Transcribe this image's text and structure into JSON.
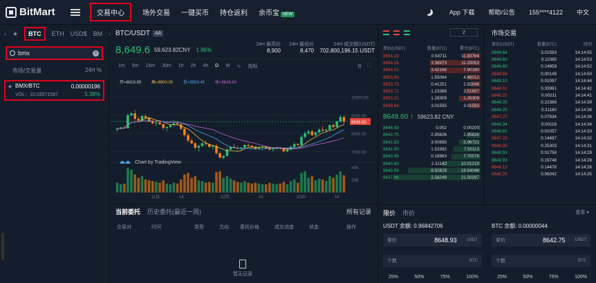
{
  "topbar": {
    "brand": "BitMart",
    "nav": [
      "交易中心",
      "场外交易",
      "一键买币",
      "持仓返利",
      "余币宝"
    ],
    "new_badge": "NEW",
    "app": "App 下载",
    "help": "帮助/公告",
    "user": "155****4122",
    "lang": "中文"
  },
  "left": {
    "tabs": [
      "BTC",
      "ETH",
      "USD$",
      "BM"
    ],
    "search_value": "bmx",
    "col_market": "市场/交易量",
    "col_change": "24H %",
    "pair": {
      "name": "BMX/BTC",
      "vol": "VOL：10.02071597",
      "price": "0.00000196",
      "change": "5.38%"
    }
  },
  "header": {
    "pair": "BTC/USDT",
    "badge": "AA",
    "price": "8,649.6",
    "cny": "59,623.82CNY",
    "change": "1.86%",
    "stats": [
      {
        "label": "24H 最高价",
        "value": "8,900"
      },
      {
        "label": "24H 最低价",
        "value": "8,470"
      },
      {
        "label": "24H 成交额(USDT)",
        "value": "702,800,196.15 USDT"
      }
    ]
  },
  "toolbar": {
    "intervals": [
      "1m",
      "5m",
      "15m",
      "30m",
      "1h",
      "2h",
      "4h",
      "D",
      "W"
    ],
    "active": "D",
    "indicator": "指标"
  },
  "chart_data": {
    "type": "candlestick",
    "ma_labels": [
      "开=8818.89",
      "高=8900.00",
      "低=8569.45",
      "收=8649.60"
    ],
    "y_ticks": [
      "10000.00",
      "9000.00",
      "8000.00",
      "7000.00"
    ],
    "vol_ticks": [
      "40K",
      "20K"
    ],
    "x_ticks": [
      "11月",
      "14",
      "12月",
      "14",
      "2020",
      "14"
    ],
    "current_price": "8649.60",
    "watermark": "Chart by TradingView",
    "candles": [
      [
        8200,
        8300,
        8100,
        8250
      ],
      [
        8250,
        8350,
        8200,
        8320
      ],
      [
        8320,
        8400,
        8250,
        8280
      ],
      [
        8280,
        9100,
        8250,
        9000
      ],
      [
        9000,
        9200,
        8900,
        9100
      ],
      [
        9100,
        9300,
        8700,
        8800
      ],
      [
        8800,
        8900,
        8600,
        8700
      ],
      [
        8700,
        9000,
        8650,
        8950
      ],
      [
        8950,
        9050,
        8800,
        8850
      ],
      [
        8850,
        8900,
        8600,
        8650
      ],
      [
        8650,
        8750,
        8500,
        8550
      ],
      [
        8550,
        8650,
        8400,
        8600
      ],
      [
        8600,
        8700,
        8450,
        8500
      ],
      [
        8500,
        8550,
        8200,
        8300
      ],
      [
        8300,
        8400,
        8100,
        8350
      ],
      [
        8350,
        8500,
        8300,
        8450
      ],
      [
        8450,
        8600,
        8400,
        8550
      ],
      [
        8550,
        8650,
        8450,
        8500
      ],
      [
        8500,
        8550,
        8200,
        8250
      ],
      [
        8250,
        8300,
        7800,
        7900
      ],
      [
        7900,
        8000,
        7500,
        7600
      ],
      [
        7600,
        7700,
        7400,
        7450
      ],
      [
        7450,
        7500,
        7100,
        7200
      ],
      [
        7200,
        7350,
        7000,
        7300
      ],
      [
        7300,
        7500,
        7250,
        7450
      ],
      [
        7450,
        7600,
        7350,
        7400
      ],
      [
        7400,
        7450,
        7200,
        7250
      ],
      [
        7250,
        7350,
        7100,
        7300
      ],
      [
        7300,
        7400,
        6800,
        6900
      ],
      [
        6900,
        7000,
        6600,
        6650
      ],
      [
        6650,
        6800,
        6550,
        6750
      ],
      [
        6750,
        7200,
        6700,
        7100
      ],
      [
        7100,
        7300,
        7050,
        7250
      ],
      [
        7250,
        7400,
        7150,
        7200
      ],
      [
        7200,
        7300,
        7100,
        7150
      ],
      [
        7150,
        7250,
        7050,
        7200
      ],
      [
        7200,
        7400,
        7150,
        7350
      ],
      [
        7350,
        7450,
        7250,
        7300
      ],
      [
        7300,
        7350,
        7200,
        7250
      ],
      [
        7250,
        7300,
        7100,
        7150
      ],
      [
        7150,
        7250,
        7100,
        7200
      ],
      [
        7200,
        7300,
        7150,
        7250
      ],
      [
        7250,
        7300,
        7150,
        7180
      ],
      [
        7180,
        7250,
        7050,
        7100
      ],
      [
        7100,
        7200,
        7000,
        7150
      ],
      [
        7150,
        7250,
        7100,
        7200
      ],
      [
        7200,
        7250,
        7100,
        7150
      ],
      [
        7150,
        7200,
        6950,
        7000
      ],
      [
        7000,
        7150,
        6950,
        7100
      ],
      [
        7100,
        7300,
        7050,
        7250
      ],
      [
        7250,
        7500,
        7200,
        7400
      ],
      [
        7400,
        7450,
        7300,
        7350
      ],
      [
        7350,
        7900,
        7300,
        7800
      ],
      [
        7800,
        8100,
        7700,
        8000
      ],
      [
        8000,
        8200,
        7900,
        8100
      ],
      [
        8100,
        8200,
        7850,
        7900
      ],
      [
        7900,
        8100,
        7850,
        8050
      ],
      [
        8050,
        8300,
        8000,
        8200
      ],
      [
        8200,
        8400,
        8100,
        8150
      ],
      [
        8150,
        8250,
        8050,
        8200
      ],
      [
        8200,
        8500,
        8150,
        8450
      ],
      [
        8450,
        8550,
        8300,
        8350
      ],
      [
        8350,
        8700,
        8300,
        8650
      ],
      [
        8650,
        9000,
        8600,
        8900
      ],
      [
        8900,
        8950,
        8500,
        8650
      ]
    ],
    "volumes": [
      12,
      10,
      11,
      30,
      28,
      22,
      18,
      20,
      16,
      15,
      14,
      13,
      12,
      15,
      11,
      10,
      12,
      11,
      16,
      22,
      24,
      18,
      20,
      15,
      14,
      12,
      13,
      12,
      25,
      26,
      18,
      20,
      17,
      15,
      13,
      12,
      14,
      12,
      11,
      12,
      11,
      10,
      10,
      12,
      11,
      10,
      11,
      13,
      10,
      14,
      16,
      12,
      24,
      26,
      18,
      20,
      15,
      17,
      16,
      14,
      20,
      18,
      22,
      26,
      21
    ]
  },
  "orders": {
    "tabs": [
      "当前委托",
      "历史委托(最近一周)"
    ],
    "all": "所有记录",
    "cols": [
      "交易对",
      "时间",
      "类型",
      "方向",
      "委托价格",
      "成交进度",
      "状态",
      "操作"
    ],
    "empty": "暂无记录"
  },
  "book": {
    "precision": "2",
    "cols": [
      "单价(USDT)",
      "数量(BTC)",
      "累计(BTC)"
    ],
    "asks": [
      [
        "8654.23",
        "0.54711",
        "11.83764"
      ],
      [
        "8654.16",
        "3.38873",
        "11.29053"
      ],
      [
        "8654.01",
        "3.42168",
        "7.90180"
      ],
      [
        "8653.93",
        "1.55064",
        "4.48012"
      ],
      [
        "8653.73",
        "0.41251",
        "2.92948"
      ],
      [
        "8653.71",
        "1.23388",
        "2.51697"
      ],
      [
        "8653.21",
        "1.28309",
        "1.28309"
      ],
      [
        "8649.64",
        "3.01593",
        "3.01593"
      ]
    ],
    "mid": "8649.60 ↑",
    "mid_cny": "59623.82 CNY",
    "bids": [
      [
        "8648.00",
        "0.002",
        "0.00200"
      ],
      [
        "8642.75",
        "2.95626",
        "2.95826"
      ],
      [
        "8641.63",
        "3.00895",
        "5.96721"
      ],
      [
        "8641.00",
        "1.53392",
        "7.50113"
      ],
      [
        "8640.99",
        "0.19963",
        "7.70076"
      ],
      [
        "8640.60",
        "2.31143",
        "10.01219"
      ],
      [
        "8640.59",
        "8.92829",
        "18.94048"
      ],
      [
        "8637.86",
        "2.56249",
        "21.50297"
      ]
    ],
    "ask_depth": [
      0.18,
      0.52,
      0.52,
      0.14,
      0.1,
      0.16,
      0.22,
      0.12
    ],
    "bid_depth": [
      0.02,
      0.14,
      0.22,
      0.28,
      0.3,
      0.4,
      0.75,
      0.9
    ]
  },
  "trades": {
    "title": "市场交易",
    "cols": [
      "单价(USDT)",
      "数量(BTC)",
      "时间"
    ],
    "rows": [
      [
        "8649.64",
        "3.01593",
        "14:14:55",
        "g"
      ],
      [
        "8649.60",
        "0.11065",
        "14:14:53",
        "g"
      ],
      [
        "8649.60",
        "0.24959",
        "14:14:52",
        "g"
      ],
      [
        "8648.98",
        "0.00149",
        "14:14:50",
        "r"
      ],
      [
        "8649.10",
        "0.01097",
        "14:14:44",
        "g"
      ],
      [
        "8648.01",
        "0.33961",
        "14:14:42",
        "r"
      ],
      [
        "8648.25",
        "0.00211",
        "14:14:41",
        "r"
      ],
      [
        "8648.25",
        "0.22366",
        "14:14:39",
        "g"
      ],
      [
        "8648.25",
        "0.31180",
        "14:14:38",
        "g"
      ],
      [
        "8647.27",
        "0.07834",
        "14:14:36",
        "r"
      ],
      [
        "8648.34",
        "0.00116",
        "14:14:34",
        "g"
      ],
      [
        "8648.92",
        "0.01057",
        "14:14:33",
        "g"
      ],
      [
        "8647.23",
        "0.14487",
        "14:14:32",
        "r"
      ],
      [
        "8648.00",
        "0.25303",
        "14:14:31",
        "r"
      ],
      [
        "8648.93",
        "0.01758",
        "14:14:29",
        "g"
      ],
      [
        "8648.93",
        "0.19748",
        "14:14:28",
        "g"
      ],
      [
        "8648.12",
        "0.14478",
        "14:14:26",
        "r"
      ],
      [
        "8648.25",
        "0.96042",
        "14:14:25",
        "r"
      ]
    ]
  },
  "trade": {
    "tabs": [
      "限价",
      "市价"
    ],
    "fee": "费率 ▾",
    "usdt_bal": "USDT 余额: 0.96842706",
    "btc_bal": "BTC 余额: 0.00000044",
    "price_label": "单价",
    "buy_price": "8648.93",
    "sell_price": "8642.75",
    "unit_usdt": "USDT",
    "qty_label": "个数",
    "unit_btc": "BTC",
    "pcts": [
      "25%",
      "50%",
      "75%",
      "100%"
    ]
  },
  "colors": {
    "up": "#2cc178",
    "down": "#e6463c",
    "accent": "#e0001b"
  }
}
